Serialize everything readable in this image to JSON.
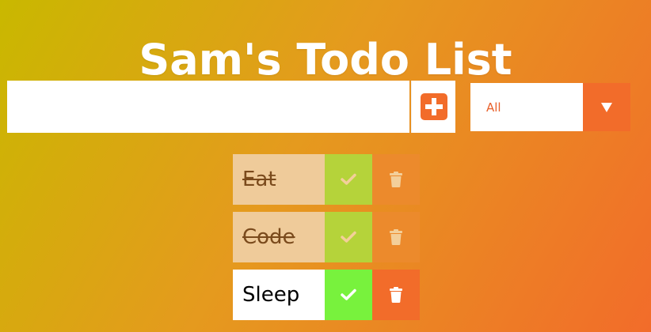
{
  "header": {
    "title": "Sam's Todo List"
  },
  "form": {
    "input_value": "",
    "input_placeholder": "",
    "add_icon": "plus-square-icon",
    "filter": {
      "selected": "All",
      "arrow_icon": "caret-down-icon"
    }
  },
  "todos": [
    {
      "text": "Eat",
      "completed": true
    },
    {
      "text": "Code",
      "completed": true
    },
    {
      "text": "Sleep",
      "completed": false
    }
  ],
  "colors": {
    "accent": "#f26c2a",
    "complete_active": "#78f23d",
    "complete_done": "#b5d33a",
    "done_item_bg": "#efcb9a",
    "gradient_start": "#c9b800",
    "gradient_end": "#f26c2a"
  }
}
